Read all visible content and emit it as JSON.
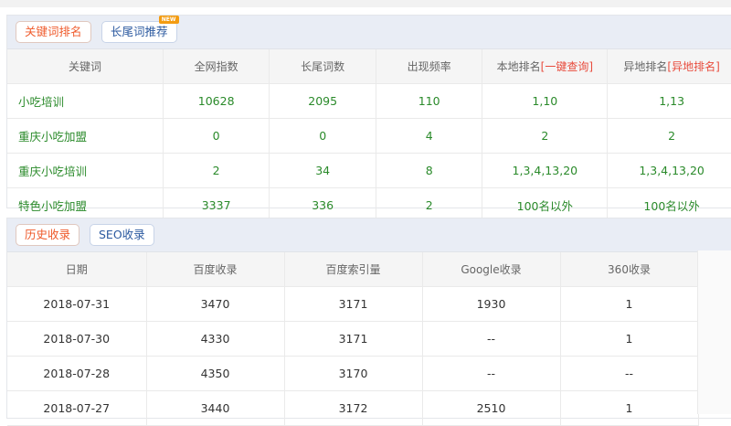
{
  "keyword_panel": {
    "tabs": [
      "关键词排名",
      "长尾词推荐"
    ],
    "new_badge": "NEW",
    "headers": {
      "keyword": "关键词",
      "index": "全网指数",
      "longtail": "长尾词数",
      "frequency": "出现频率",
      "local_rank": "本地排名",
      "local_link": "[一键查询]",
      "remote_rank": "异地排名",
      "remote_link": "[异地排名]"
    },
    "rows": [
      {
        "keyword": "小吃培训",
        "index": "10628",
        "longtail": "2095",
        "frequency": "110",
        "local": "1,10",
        "remote": "1,13"
      },
      {
        "keyword": "重庆小吃加盟",
        "index": "0",
        "longtail": "0",
        "frequency": "4",
        "local": "2",
        "remote": "2"
      },
      {
        "keyword": "重庆小吃培训",
        "index": "2",
        "longtail": "34",
        "frequency": "8",
        "local": "1,3,4,13,20",
        "remote": "1,3,4,13,20"
      },
      {
        "keyword": "特色小吃加盟",
        "index": "3337",
        "longtail": "336",
        "frequency": "2",
        "local": "100名以外",
        "remote": "100名以外"
      }
    ]
  },
  "history_panel": {
    "tabs": [
      "历史收录",
      "SEO收录"
    ],
    "headers": [
      "日期",
      "百度收录",
      "百度索引量",
      "Google收录",
      "360收录"
    ],
    "rows": [
      [
        "2018-07-31",
        "3470",
        "3171",
        "1930",
        "1"
      ],
      [
        "2018-07-30",
        "4330",
        "3171",
        "--",
        "1"
      ],
      [
        "2018-07-28",
        "4350",
        "3170",
        "--",
        "--"
      ],
      [
        "2018-07-27",
        "3440",
        "3172",
        "2510",
        "1"
      ]
    ]
  }
}
